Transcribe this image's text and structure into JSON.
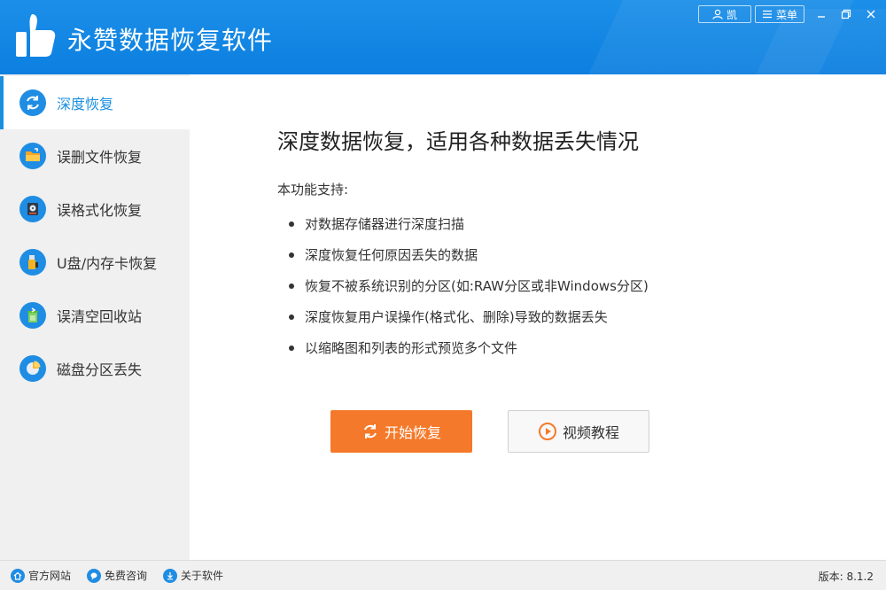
{
  "app": {
    "title": "永赞数据恢复软件",
    "user_label": "凯",
    "menu_label": "菜单"
  },
  "colors": {
    "header": "#0c7fe0",
    "accent": "#1a8fe0",
    "start_button": "#f5792a",
    "sidebar_bg": "#f0f0f0"
  },
  "sidebar": {
    "items": [
      {
        "label": "深度恢复",
        "icon": "refresh-icon",
        "active": true
      },
      {
        "label": "误删文件恢复",
        "icon": "folder-icon",
        "active": false
      },
      {
        "label": "误格式化恢复",
        "icon": "hard-disk-icon",
        "active": false
      },
      {
        "label": "U盘/内存卡恢复",
        "icon": "usb-drive-icon",
        "active": false
      },
      {
        "label": "误清空回收站",
        "icon": "recycle-bin-icon",
        "active": false
      },
      {
        "label": "磁盘分区丢失",
        "icon": "pie-chart-icon",
        "active": false
      }
    ]
  },
  "main": {
    "title": "深度数据恢复，适用各种数据丢失情况",
    "support_label": "本功能支持:",
    "features": [
      "对数据存储器进行深度扫描",
      "深度恢复任何原因丢失的数据",
      "恢复不被系统识别的分区(如:RAW分区或非Windows分区)",
      "深度恢复用户误操作(格式化、删除)导致的数据丢失",
      "以缩略图和列表的形式预览多个文件"
    ],
    "start_button": "开始恢复",
    "video_button": "视频教程"
  },
  "footer": {
    "links": [
      "官方网站",
      "免费咨询",
      "关于软件"
    ],
    "version": "版本: 8.1.2"
  }
}
